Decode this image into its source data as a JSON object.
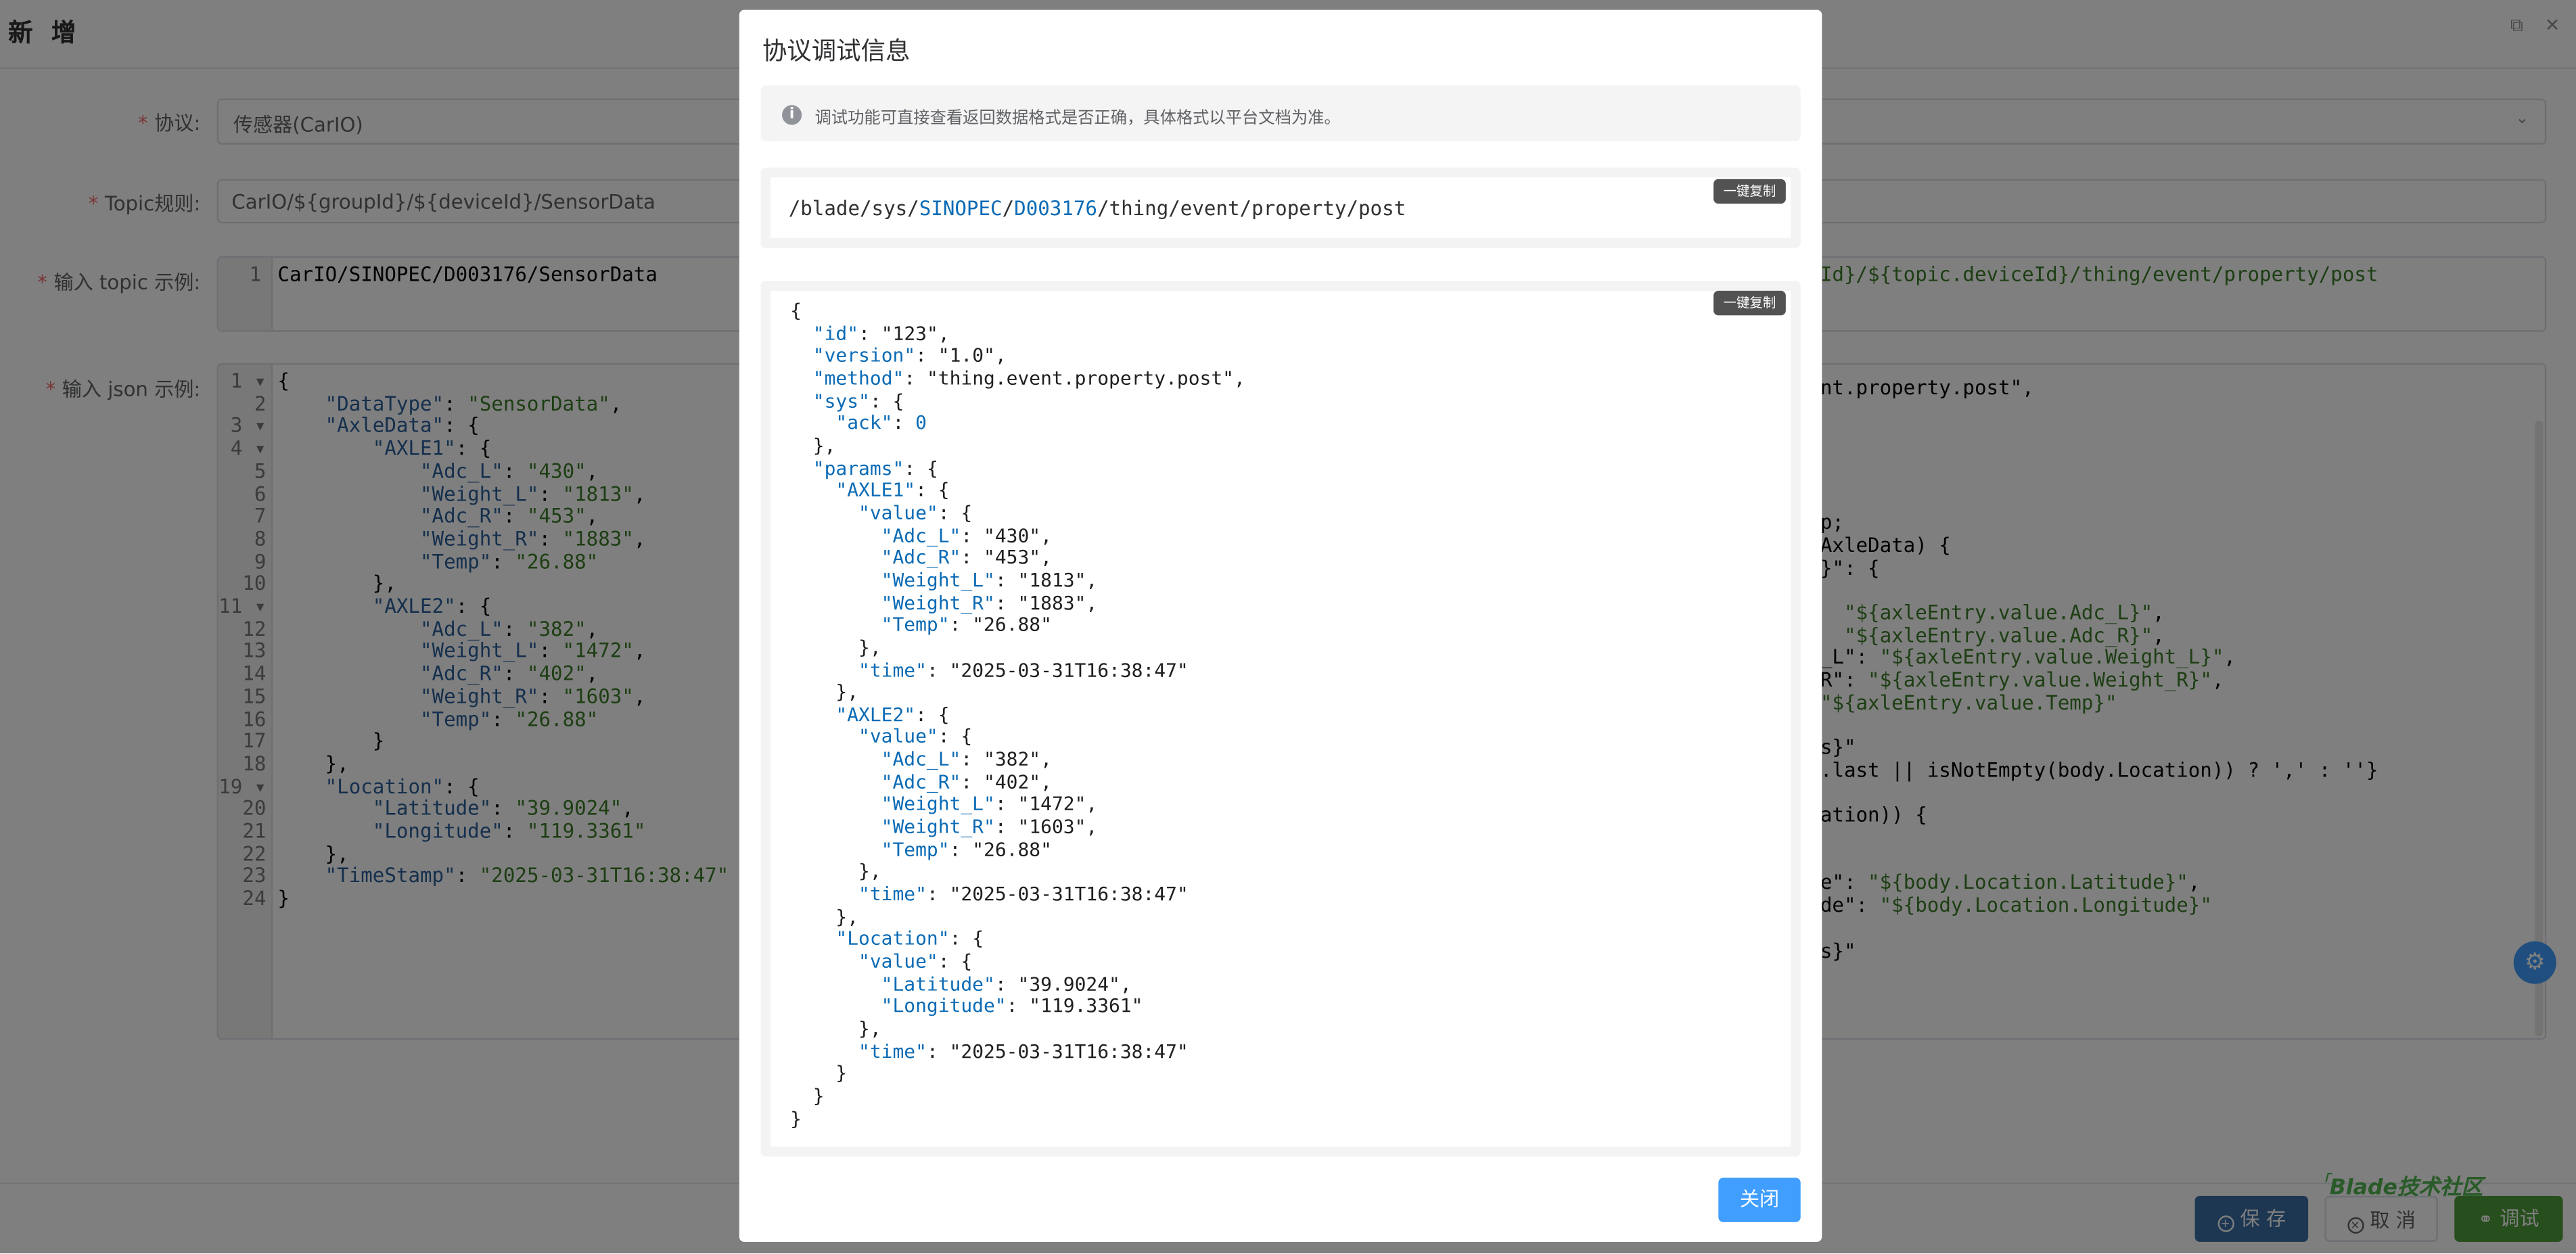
{
  "page": {
    "title": "新 增"
  },
  "form": {
    "protocol": {
      "label": "协议:",
      "value": "传感器(CarIO)"
    },
    "topic_rule": {
      "label": "Topic规则:",
      "value": "CarIO/${groupId}/${deviceId}/SensorData"
    },
    "topic_example": {
      "label": "输入 topic 示例:",
      "line_no": "1",
      "value": "CarIO/SINOPEC/D003176/SensorData",
      "right_fragment": "Id}/${topic.deviceId}/thing/event/property/post"
    },
    "json_example": {
      "label": "输入 json 示例:"
    }
  },
  "json_editor": {
    "line_numbers": [
      "1 ▾",
      "2",
      "3 ▾",
      "4 ▾",
      "5",
      "6",
      "7",
      "8",
      "9",
      "10",
      "11 ▾",
      "12",
      "13",
      "14",
      "15",
      "16",
      "17",
      "18",
      "19 ▾",
      "20",
      "21",
      "22",
      "23",
      "24"
    ],
    "lines": [
      "{",
      "    \"DataType\": \"SensorData\",",
      "    \"AxleData\": {",
      "        \"AXLE1\": {",
      "            \"Adc_L\": \"430\",",
      "            \"Weight_L\": \"1813\",",
      "            \"Adc_R\": \"453\",",
      "            \"Weight_R\": \"1883\",",
      "            \"Temp\": \"26.88\"",
      "        },",
      "        \"AXLE2\": {",
      "            \"Adc_L\": \"382\",",
      "            \"Weight_L\": \"1472\",",
      "            \"Adc_R\": \"402\",",
      "            \"Weight_R\": \"1603\",",
      "            \"Temp\": \"26.88\"",
      "        }",
      "    },",
      "    \"Location\": {",
      "        \"Latitude\": \"39.9024\",",
      "        \"Longitude\": \"119.3361\"",
      "    },",
      "    \"TimeStamp\": \"2025-03-31T16:38:47\"",
      "}"
    ]
  },
  "script_fragment": {
    "lines": [
      "nt.property.post\",",
      "",
      "",
      "",
      "",
      "",
      "p;",
      "AxleData) {",
      "}\": {",
      "",
      "  \"${axleEntry.value.Adc_L}\",",
      "  \"${axleEntry.value.Adc_R}\",",
      "_L\": \"${axleEntry.value.Weight_L}\",",
      "R\": \"${axleEntry.value.Weight_R}\",",
      "\"${axleEntry.value.Temp}\"",
      "",
      "s}\"",
      ".last || isNotEmpty(body.Location)) ? ',' : ''}",
      "",
      "ation)) {",
      "",
      "",
      "e\": \"${body.Location.Latitude}\",",
      "de\": \"${body.Location.Longitude}\"",
      "",
      "s}\""
    ]
  },
  "modal": {
    "title": "协议调试信息",
    "info_text": "调试功能可直接查看返回数据格式是否正确，具体格式以平台文档为准。",
    "info_icon": "info-icon",
    "copy_label": "一键复制",
    "path": {
      "p1": "/blade/sys/",
      "p2": "SINOPEC",
      "p3": "/",
      "p4": "D003176",
      "p5": "/thing/event/property/post"
    },
    "close_label": "关闭",
    "json_lines": [
      "{",
      "  \"id\": \"123\",",
      "  \"version\": \"1.0\",",
      "  \"method\": \"thing.event.property.post\",",
      "  \"sys\": {",
      "    \"ack\": 0",
      "  },",
      "  \"params\": {",
      "    \"AXLE1\": {",
      "      \"value\": {",
      "        \"Adc_L\": \"430\",",
      "        \"Adc_R\": \"453\",",
      "        \"Weight_L\": \"1813\",",
      "        \"Weight_R\": \"1883\",",
      "        \"Temp\": \"26.88\"",
      "      },",
      "      \"time\": \"2025-03-31T16:38:47\"",
      "    },",
      "    \"AXLE2\": {",
      "      \"value\": {",
      "        \"Adc_L\": \"382\",",
      "        \"Adc_R\": \"402\",",
      "        \"Weight_L\": \"1472\",",
      "        \"Weight_R\": \"1603\",",
      "        \"Temp\": \"26.88\"",
      "      },",
      "      \"time\": \"2025-03-31T16:38:47\"",
      "    },",
      "    \"Location\": {",
      "      \"value\": {",
      "        \"Latitude\": \"39.9024\",",
      "        \"Longitude\": \"119.3361\"",
      "      },",
      "      \"time\": \"2025-03-31T16:38:47\"",
      "    }",
      "  }",
      "}"
    ]
  },
  "footer": {
    "save_label": "保 存",
    "cancel_label": "取 消",
    "debug_label": "调试",
    "watermark": "Blade技术社区"
  },
  "icons": {
    "settings": "gear-icon",
    "restore": "restore-window-icon",
    "close": "close-icon"
  },
  "colors": {
    "primary": "#409eff",
    "save": "#3a6ea5",
    "debug": "#4f9d3a",
    "required": "#f56c6c"
  }
}
